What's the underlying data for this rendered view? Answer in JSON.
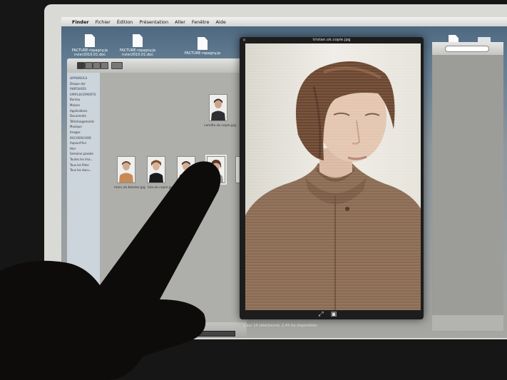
{
  "menubar": {
    "apple_glyph": "",
    "items": [
      "Finder",
      "Fichier",
      "Édition",
      "Présentation",
      "Aller",
      "Fenêtre",
      "Aide"
    ]
  },
  "desktop": {
    "icons": [
      {
        "label_line1": "FACTURE-ropagny.ja",
        "label_line2": "nvier2010.01.doc"
      },
      {
        "label_line1": "FACTURE-ropagny.ja",
        "label_line2": "nvier2010.01.doc"
      },
      {
        "label_line1": "FACTURE-ropagny.ja",
        "label_line2": ""
      }
    ]
  },
  "finder": {
    "sidebar": [
      {
        "label": "APPAREILS",
        "header": true
      },
      {
        "label": "Disque dur",
        "header": false
      },
      {
        "label": "",
        "header": false
      },
      {
        "label": "PARTAGÉS",
        "header": true
      },
      {
        "label": "",
        "header": false
      },
      {
        "label": "EMPLACEMENTS",
        "header": true
      },
      {
        "label": "Bureau",
        "header": false
      },
      {
        "label": "Maison",
        "header": false
      },
      {
        "label": "Applications",
        "header": false
      },
      {
        "label": "Documents",
        "header": false
      },
      {
        "label": "Téléchargements",
        "header": false
      },
      {
        "label": "Musique",
        "header": false
      },
      {
        "label": "Images",
        "header": false
      },
      {
        "label": "RECHERCHER",
        "header": true
      },
      {
        "label": "Aujourd'hui",
        "header": false
      },
      {
        "label": "Hier",
        "header": false
      },
      {
        "label": "Semaine passée",
        "header": false
      },
      {
        "label": "Toutes les ima...",
        "header": false
      },
      {
        "label": "Tous les films",
        "header": false
      },
      {
        "label": "Tous les docu...",
        "header": false
      }
    ],
    "thumbnails": [
      {
        "label": "camille.ok.copie.jpg"
      },
      {
        "label": "marc.ok.bleuter.jpg"
      },
      {
        "label": "lola.ok.copie.jpg"
      },
      {
        "label": ""
      },
      {
        "label": ""
      }
    ],
    "status_text": "1 sur 14 sélectionné, 2,44 Go disponibles"
  },
  "quicklook": {
    "title": "tristan.ok.copie.jpg",
    "close_glyph": "✕",
    "fullscreen_glyph": "⤢",
    "iphoto_glyph": "▣"
  },
  "progress": {
    "value": 0.28
  },
  "colors": {
    "finger": "#0e0c0b",
    "selection_blue": "#5f88b8",
    "quicklook_bg": "#1d1d1d",
    "sweater": "#8a6a52",
    "hair": "#6b4630",
    "skin": "#e3c5b0"
  }
}
